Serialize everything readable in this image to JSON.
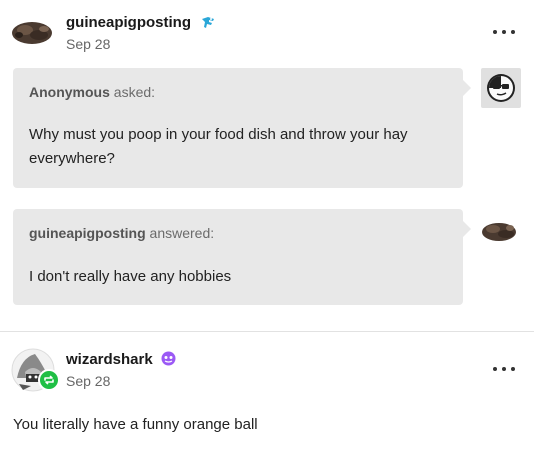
{
  "post1": {
    "blog_name": "guineapigposting",
    "date": "Sep 28",
    "badge_icon": "fish-badge-icon",
    "ask": {
      "asker": "Anonymous",
      "verb": "asked:",
      "question": "Why must you poop in your food dish and throw your hay everywhere?"
    },
    "answer": {
      "answerer": "guineapigposting",
      "verb": "answered:",
      "text": "I don't really have any hobbies"
    }
  },
  "post2": {
    "blog_name": "wizardshark",
    "date": "Sep 28",
    "badge_icon": "purple-face-badge-icon",
    "body": "You literally have a funny orange ball"
  },
  "colors": {
    "bubble": "#e8e8e8",
    "reblog_green": "#1fbf45",
    "badge_purple": "#9b59f5",
    "badge_teal": "#2aa7d8"
  }
}
